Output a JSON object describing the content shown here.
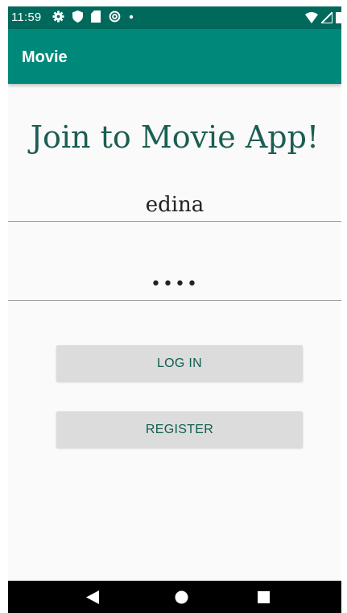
{
  "status_bar": {
    "time": "11:59",
    "icons": [
      "gear-icon",
      "shield-icon",
      "sd-card-icon",
      "sync-icon",
      "dot-icon",
      "wifi-icon",
      "signal-icon",
      "battery-icon"
    ],
    "color": "#00695c"
  },
  "app_bar": {
    "title": "Movie",
    "color": "#00897b"
  },
  "main": {
    "heading": "Join to Movie App!",
    "username_value": "edina",
    "password_value": "••••"
  },
  "buttons": {
    "login_label": "LOG IN",
    "register_label": "REGISTER"
  },
  "nav_bar": {
    "icons": [
      "back-icon",
      "home-icon",
      "recents-icon"
    ]
  },
  "colors": {
    "accent": "#00897b",
    "heading": "#1b5e53",
    "button_text": "#115e4f",
    "button_bg": "#dcdcdc"
  }
}
